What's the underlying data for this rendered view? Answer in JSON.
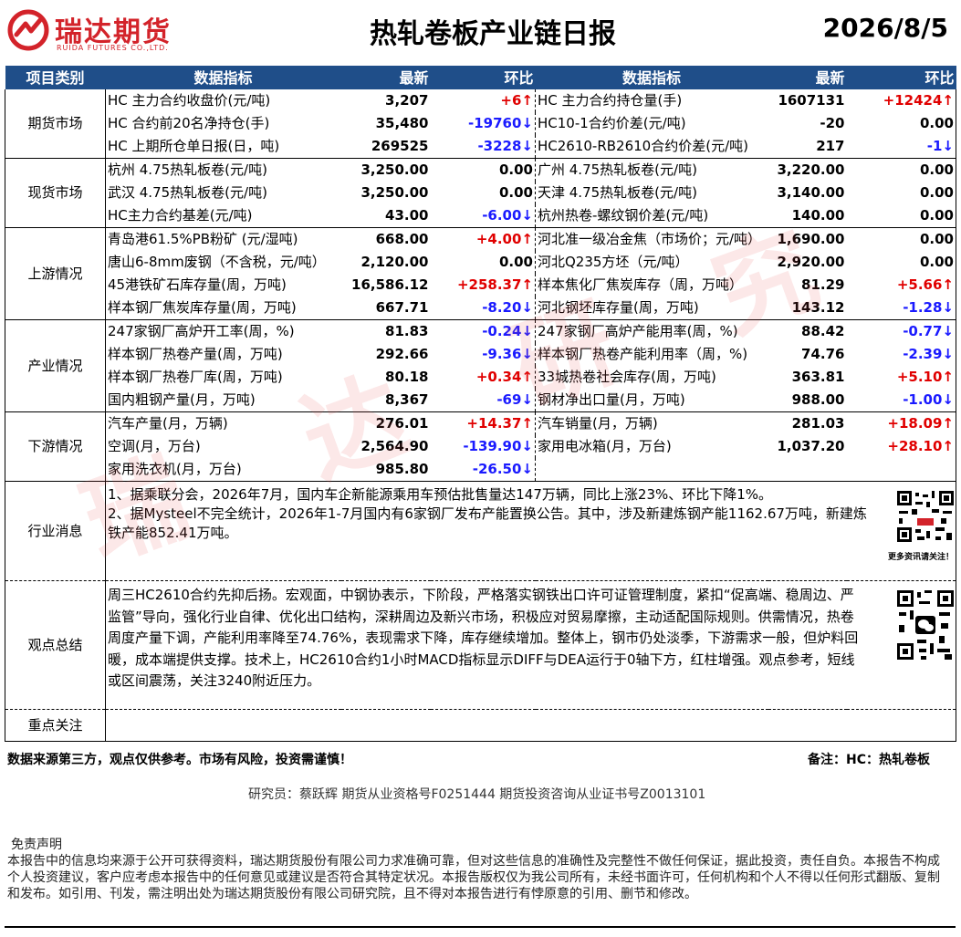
{
  "header": {
    "logo_cn": "瑞达期货",
    "logo_en": "RUIDA FUTURES CO.,LTD.",
    "title": "热轧卷板产业链日报",
    "date": "2026/8/5"
  },
  "colors": {
    "header_bg": "#1f4e89",
    "up": "#e00000",
    "down": "#1a1aff",
    "logo": "#d3232a"
  },
  "columns": {
    "category": "项目类别",
    "indicator": "数据指标",
    "latest": "最新",
    "change": "环比",
    "indicator2": "数据指标",
    "latest2": "最新",
    "change2": "环比"
  },
  "sections": [
    {
      "category": "期货市场",
      "rows": [
        {
          "l_name": "HC 主力合约收盘价(元/吨)",
          "l_val": "3,207",
          "l_chg": "+6↑",
          "l_dir": "up",
          "r_name": "HC 主力合约持仓量(手)",
          "r_val": "1607131",
          "r_chg": "+12424↑",
          "r_dir": "up"
        },
        {
          "l_name": "HC 合约前20名净持仓(手)",
          "l_val": "35,480",
          "l_chg": "-19760↓",
          "l_dir": "down",
          "r_name": "HC10-1合约价差(元/吨)",
          "r_val": "-20",
          "r_chg": "0.00",
          "r_dir": "zero"
        },
        {
          "l_name": "HC 上期所仓单日报(日，吨)",
          "l_val": "269525",
          "l_chg": "-3228↓",
          "l_dir": "down",
          "r_name": "HC2610-RB2610合约价差(元/吨)",
          "r_val": "217",
          "r_chg": "-1↓",
          "r_dir": "down"
        }
      ]
    },
    {
      "category": "现货市场",
      "rows": [
        {
          "l_name": "杭州 4.75热轧板卷(元/吨)",
          "l_val": "3,250.00",
          "l_chg": "0.00",
          "l_dir": "zero",
          "r_name": "广州 4.75热轧板卷(元/吨)",
          "r_val": "3,220.00",
          "r_chg": "0.00",
          "r_dir": "zero"
        },
        {
          "l_name": "武汉 4.75热轧板卷(元/吨)",
          "l_val": "3,250.00",
          "l_chg": "0.00",
          "l_dir": "zero",
          "r_name": "天津 4.75热轧板卷(元/吨)",
          "r_val": "3,140.00",
          "r_chg": "0.00",
          "r_dir": "zero"
        },
        {
          "l_name": "HC主力合约基差(元/吨)",
          "l_val": "43.00",
          "l_chg": "-6.00↓",
          "l_dir": "down",
          "r_name": "杭州热卷-螺纹钢价差(元/吨)",
          "r_val": "140.00",
          "r_chg": "0.00",
          "r_dir": "zero"
        }
      ]
    },
    {
      "category": "上游情况",
      "rows": [
        {
          "l_name": "青岛港61.5%PB粉矿 (元/湿吨)",
          "l_val": "668.00",
          "l_chg": "+4.00↑",
          "l_dir": "up",
          "r_name": "河北准一级冶金焦（市场价；元/吨）",
          "r_val": "1,690.00",
          "r_chg": "0.00",
          "r_dir": "zero"
        },
        {
          "l_name": "唐山6-8mm废钢（不含税，元/吨）",
          "l_val": "2,120.00",
          "l_chg": "0.00",
          "l_dir": "zero",
          "r_name": "河北Q235方坯（元/吨）",
          "r_val": "2,920.00",
          "r_chg": "0.00",
          "r_dir": "zero"
        },
        {
          "l_name": "45港铁矿石库存量(周，万吨)",
          "l_val": "16,586.12",
          "l_chg": "+258.37↑",
          "l_dir": "up",
          "r_name": "样本焦化厂焦炭库存（周，万吨）",
          "r_val": "81.29",
          "r_chg": "+5.66↑",
          "r_dir": "up"
        },
        {
          "l_name": "样本钢厂焦炭库存量(周，万吨)",
          "l_val": "667.71",
          "l_chg": "-8.20↓",
          "l_dir": "down",
          "r_name": "河北钢坯库存量(周，万吨)",
          "r_val": "143.12",
          "r_chg": "-1.28↓",
          "r_dir": "down"
        }
      ]
    },
    {
      "category": "产业情况",
      "rows": [
        {
          "l_name": "247家钢厂高炉开工率(周，%)",
          "l_val": "81.83",
          "l_chg": "-0.24↓",
          "l_dir": "down",
          "r_name": "247家钢厂高炉产能用率(周，%)",
          "r_val": "88.42",
          "r_chg": "-0.77↓",
          "r_dir": "down"
        },
        {
          "l_name": "样本钢厂热卷产量(周，万吨)",
          "l_val": "292.66",
          "l_chg": "-9.36↓",
          "l_dir": "down",
          "r_name": "样本钢厂热卷产能利用率（周，%)",
          "r_val": "74.76",
          "r_chg": "-2.39↓",
          "r_dir": "down"
        },
        {
          "l_name": "样本钢厂热卷厂库(周，万吨)",
          "l_val": "80.18",
          "l_chg": "+0.34↑",
          "l_dir": "up",
          "r_name": "33城热卷社会库存(周，万吨)",
          "r_val": "363.81",
          "r_chg": "+5.10↑",
          "r_dir": "up"
        },
        {
          "l_name": "国内粗钢产量(月，万吨)",
          "l_val": "8,367",
          "l_chg": "-69↓",
          "l_dir": "down",
          "r_name": "钢材净出口量(月，万吨)",
          "r_val": "988.00",
          "r_chg": "-1.00↓",
          "r_dir": "down"
        }
      ]
    },
    {
      "category": "下游情况",
      "rows": [
        {
          "l_name": "汽车产量(月，万辆)",
          "l_val": "276.01",
          "l_chg": "+14.37↑",
          "l_dir": "up",
          "r_name": "汽车销量(月，万辆)",
          "r_val": "281.03",
          "r_chg": "+18.09↑",
          "r_dir": "up"
        },
        {
          "l_name": "空调(月，万台)",
          "l_val": "2,564.90",
          "l_chg": "-139.90↓",
          "l_dir": "down",
          "r_name": "家用电冰箱(月，万台)",
          "r_val": "1,037.20",
          "r_chg": "+28.10↑",
          "r_dir": "up"
        },
        {
          "l_name": "家用洗衣机(月，万台)",
          "l_val": "985.80",
          "l_chg": "-26.50↓",
          "l_dir": "down",
          "r_name": "",
          "r_val": "",
          "r_chg": "",
          "r_dir": "zero"
        }
      ]
    }
  ],
  "news": {
    "category": "行业消息",
    "lines": [
      "1、据乘联分会，2026年7月，国内车企新能源乘用车预估批售量达147万辆，同比上涨23%、环比下降1%。",
      "2、据Mysteel不完全统计，2026年1-7月国内有6家钢厂发布产能置换公告。其中，涉及新建炼钢产能1162.67万吨，新建炼铁产能852.41万吨。"
    ],
    "qr_caption": "更多资讯请关注！"
  },
  "view": {
    "category": "观点总结",
    "text": "周三HC2610合约先抑后扬。宏观面，中钢协表示，下阶段，严格落实钢铁出口许可证管理制度，紧扣“促高端、稳周边、严监管”导向，强化行业自律、优化出口结构，深耕周边及新兴市场，积极应对贸易摩擦，主动适配国际规则。供需情况，热卷周度产量下调，产能利用率降至74.76%，表现需求下降，库存继续增加。整体上，钢市仍处淡季，下游需求一般，但炉料回暖，成本端提供支撑。技术上，HC2610合约1小时MACD指标显示DIFF与DEA运行于0轴下方，红柱增强。观点参考，短线或区间震荡，关注3240附近压力。"
  },
  "focus": {
    "category": "重点关注",
    "text": ""
  },
  "footer": {
    "note": "数据来源第三方，观点仅供参考。市场有风险，投资需谨慎！",
    "remark": "备注：HC：热轧卷板",
    "researcher": "研究员：蔡跃辉    期货从业资格号F0251444    期货投资咨询从业证书号Z0013101",
    "disclaimer_title": "免责声明",
    "disclaimer": "本报告中的信息均来源于公开可获得资料，瑞达期货股份有限公司力求准确可靠，但对这些信息的准确性及完整性不做任何保证，据此投资，责任自负。本报告不构成个人投资建议，客户应考虑本报告中的任何意见或建议是否符合其特定状况。本报告版权仅为我公司所有，未经书面许可，任何机构和个人不得以任何形式翻版、复制和发布。如引用、刊发，需注明出处为瑞达期货股份有限公司研究院，且不得对本报告进行有悖原意的引用、删节和修改。",
    "watermark": [
      "瑞",
      "达",
      "研",
      "究"
    ]
  }
}
